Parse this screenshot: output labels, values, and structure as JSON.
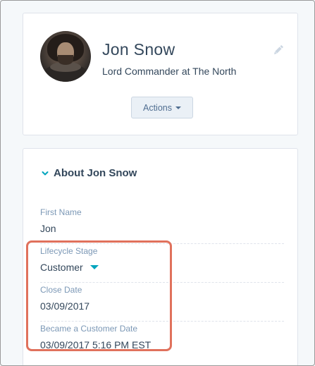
{
  "profile": {
    "name": "Jon Snow",
    "subtitle": "Lord Commander at The North",
    "actions_label": "Actions"
  },
  "about": {
    "title": "About Jon Snow",
    "fields": [
      {
        "label": "First Name",
        "value": "Jon"
      },
      {
        "label": "Lifecycle Stage",
        "value": "Customer"
      },
      {
        "label": "Close Date",
        "value": "03/09/2017"
      },
      {
        "label": "Became a Customer Date",
        "value": "03/09/2017 5:16 PM EST"
      }
    ]
  },
  "colors": {
    "accent": "#00a4bd",
    "highlight": "#e0715c",
    "text": "#33475b",
    "label": "#7c98b6"
  },
  "icons": [
    "pencil-icon",
    "chevron-down-icon",
    "caret-down-icon"
  ]
}
